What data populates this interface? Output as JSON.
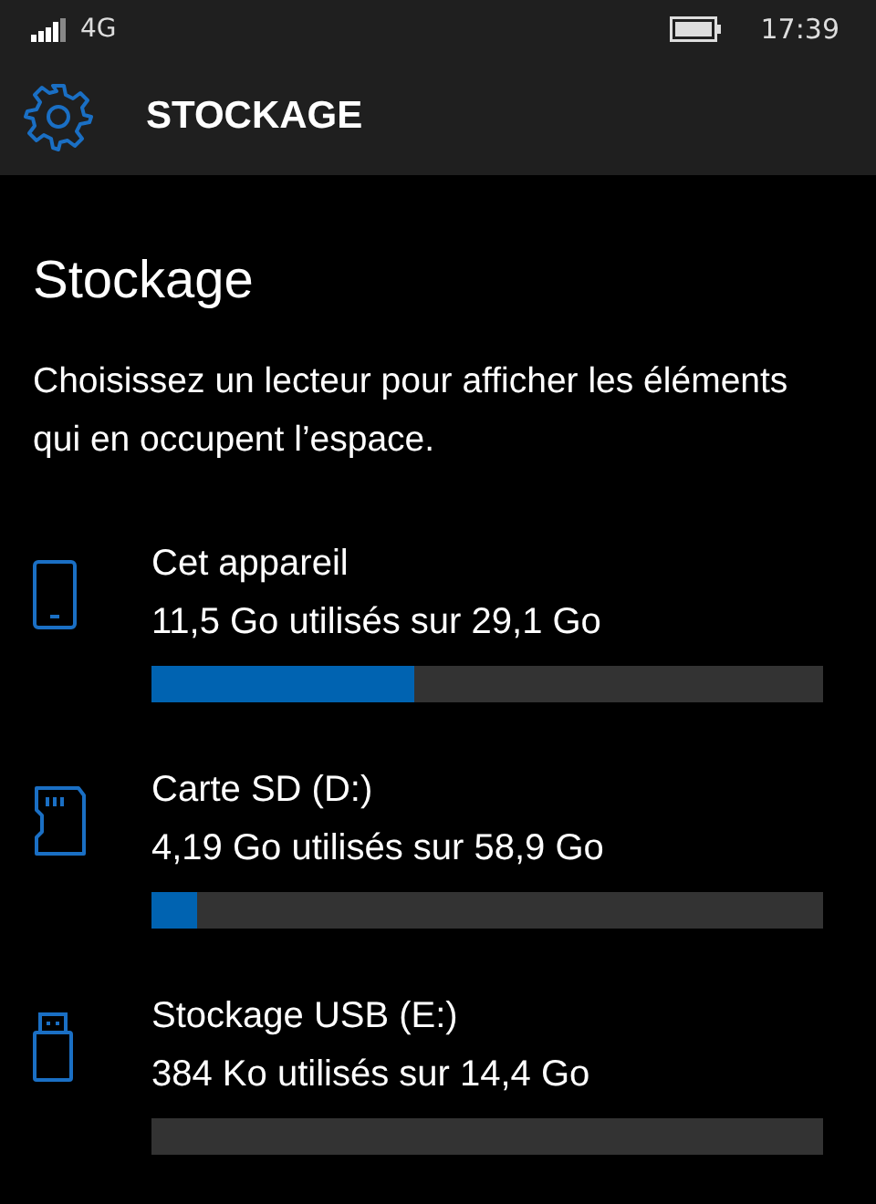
{
  "status_bar": {
    "network": "4G",
    "time": "17:39"
  },
  "header": {
    "title": "STOCKAGE"
  },
  "page": {
    "title": "Stockage",
    "description": "Choisissez un lecteur pour afficher les éléments qui en occupent l’espace."
  },
  "drives": [
    {
      "kind": "phone",
      "name": "Cet appareil",
      "usage": "11,5 Go utilisés sur 29,1 Go",
      "level": 0.39
    },
    {
      "kind": "sd",
      "name": "Carte SD (D:)",
      "usage": "4,19 Go utilisés sur 58,9 Go",
      "level": 0.068
    },
    {
      "kind": "usb",
      "name": "Stockage USB (E:)",
      "usage": "384 Ko utilisés sur 14,4 Go",
      "level": 0
    }
  ]
}
